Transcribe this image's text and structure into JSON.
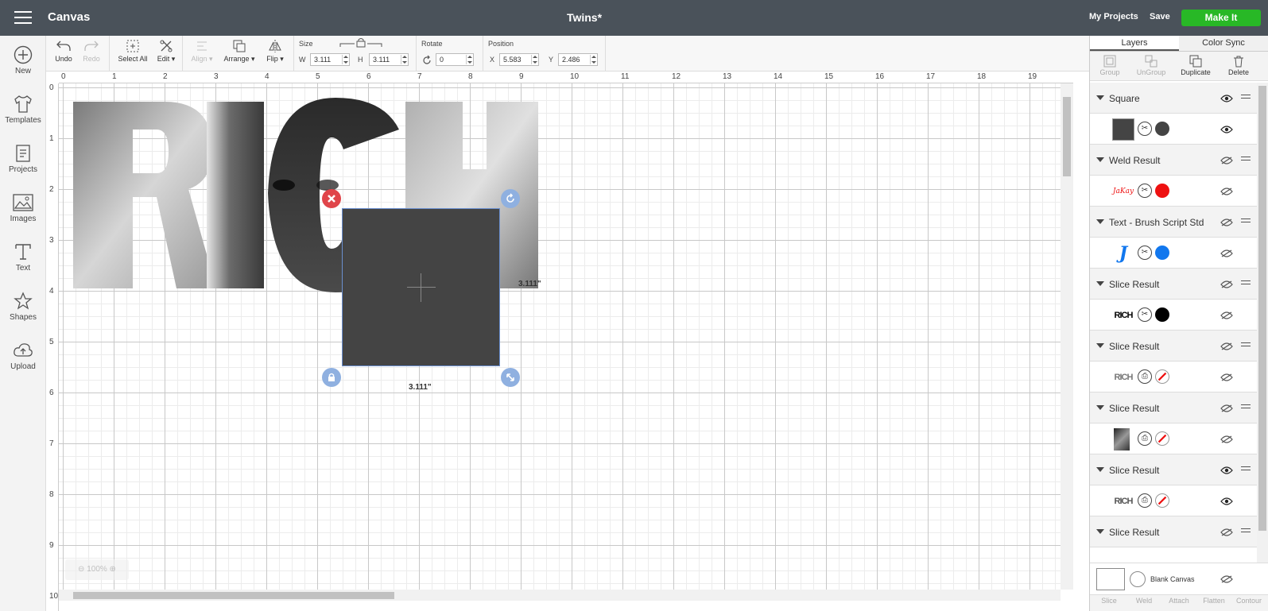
{
  "topbar": {
    "app_title": "Canvas",
    "doc_title": "Twins*",
    "my_projects": "My Projects",
    "save": "Save",
    "make_it": "Make It"
  },
  "leftbar": [
    {
      "label": "New",
      "icon": "plus-circle-icon"
    },
    {
      "label": "Templates",
      "icon": "tshirt-icon"
    },
    {
      "label": "Projects",
      "icon": "projects-icon"
    },
    {
      "label": "Images",
      "icon": "images-icon"
    },
    {
      "label": "Text",
      "icon": "text-icon"
    },
    {
      "label": "Shapes",
      "icon": "shapes-icon"
    },
    {
      "label": "Upload",
      "icon": "upload-cloud-icon"
    }
  ],
  "toolbar": {
    "undo": "Undo",
    "redo": "Redo",
    "select_all": "Select All",
    "edit": "Edit",
    "align": "Align",
    "arrange": "Arrange",
    "flip": "Flip",
    "size_label": "Size",
    "w_label": "W",
    "w_value": "3.111",
    "h_label": "H",
    "h_value": "3.111",
    "rotate_label": "Rotate",
    "rotate_value": "0",
    "position_label": "Position",
    "x_label": "X",
    "x_value": "5.583",
    "y_label": "Y",
    "y_value": "2.486"
  },
  "canvas": {
    "ruler_x": [
      "0",
      "1",
      "2",
      "3",
      "4",
      "5",
      "6",
      "7",
      "8",
      "9",
      "10",
      "11",
      "12",
      "13",
      "14",
      "15",
      "16",
      "17",
      "18",
      "19"
    ],
    "ruler_y": [
      "0",
      "1",
      "2",
      "3",
      "4",
      "5",
      "6",
      "7",
      "8",
      "9",
      "10"
    ],
    "art_text": "RICH",
    "width_label": "3.111\"",
    "height_label": "3.111\"",
    "zoom": "100%"
  },
  "panel": {
    "tabs": [
      "Layers",
      "Color Sync"
    ],
    "actions": [
      {
        "label": "Group",
        "enabled": false
      },
      {
        "label": "UnGroup",
        "enabled": false
      },
      {
        "label": "Duplicate",
        "enabled": true
      },
      {
        "label": "Delete",
        "enabled": true
      }
    ],
    "layers": [
      {
        "name": "Square",
        "visible": true,
        "thumb": "dark-square",
        "op": "cut",
        "color": "#444444",
        "child_visible": true
      },
      {
        "name": "Weld Result",
        "visible": false,
        "thumb": "script-text",
        "thumb_text": "JaKay",
        "op": "cut",
        "color": "#ee1111",
        "child_visible": false
      },
      {
        "name": "Text - Brush Script Std",
        "visible": false,
        "thumb": "script-j",
        "thumb_text": "J",
        "op": "cut",
        "color": "#1177ee",
        "child_visible": false
      },
      {
        "name": "Slice Result",
        "visible": false,
        "thumb": "rich-black",
        "thumb_text": "RICH",
        "op": "cut",
        "color": "#000000",
        "child_visible": false
      },
      {
        "name": "Slice Result",
        "visible": false,
        "thumb": "rich-photo",
        "thumb_text": "RICH",
        "op": "print",
        "color": "none",
        "child_visible": false
      },
      {
        "name": "Slice Result",
        "visible": false,
        "thumb": "photo",
        "op": "print",
        "color": "none",
        "child_visible": false
      },
      {
        "name": "Slice Result",
        "visible": true,
        "thumb": "rich-photo",
        "thumb_text": "RICH",
        "op": "print",
        "color": "none",
        "child_visible": true
      },
      {
        "name": "Slice Result",
        "visible": false
      }
    ],
    "blank_canvas": "Blank Canvas",
    "bottom_actions": [
      "Slice",
      "Weld",
      "Attach",
      "Flatten",
      "Contour"
    ]
  }
}
